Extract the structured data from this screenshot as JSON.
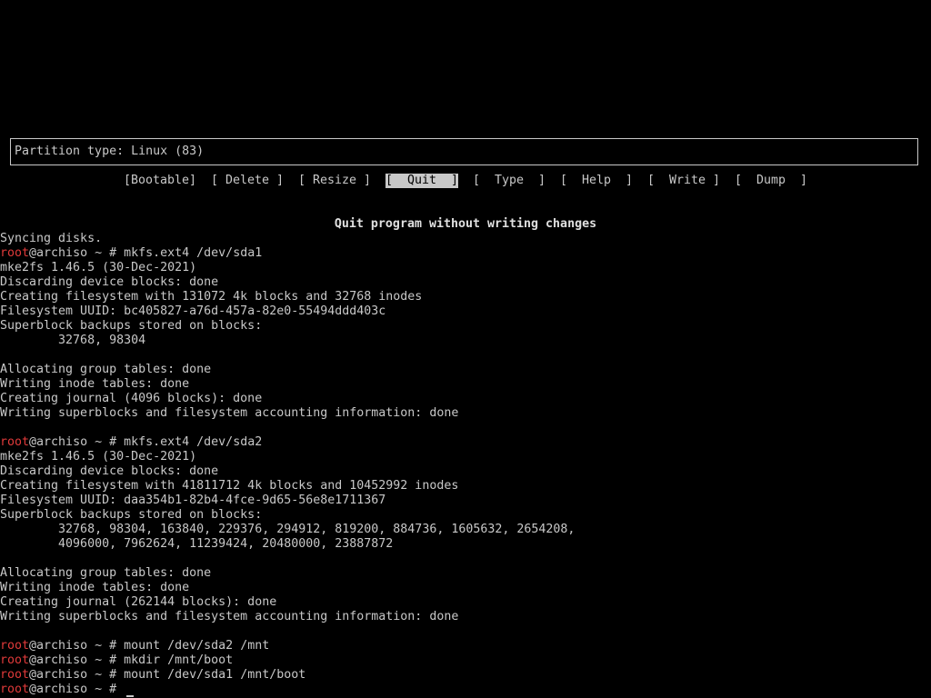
{
  "header": {
    "partition_type": "Partition type: Linux (83)"
  },
  "menu": {
    "items": [
      {
        "label": "[Bootable]"
      },
      {
        "label": "[ Delete ]"
      },
      {
        "label": "[ Resize ]"
      },
      {
        "label": "[  Quit  ]"
      },
      {
        "label": "[  Type  ]"
      },
      {
        "label": "[  Help  ]"
      },
      {
        "label": "[  Write ]"
      },
      {
        "label": "[  Dump  ]"
      }
    ],
    "selected": "Quit"
  },
  "hint": "Quit program without writing changes",
  "console": {
    "root_user": "root",
    "prompt_rest": "@archiso ~ # ",
    "lines": [
      "Syncing disks.",
      "mkfs.ext4 /dev/sda1",
      "mke2fs 1.46.5 (30-Dec-2021)",
      "Discarding device blocks: done",
      "Creating filesystem with 131072 4k blocks and 32768 inodes",
      "Filesystem UUID: bc405827-a76d-457a-82e0-55494ddd403c",
      "Superblock backups stored on blocks:",
      "        32768, 98304",
      "",
      "Allocating group tables: done",
      "Writing inode tables: done",
      "Creating journal (4096 blocks): done",
      "Writing superblocks and filesystem accounting information: done",
      "",
      "mkfs.ext4 /dev/sda2",
      "mke2fs 1.46.5 (30-Dec-2021)",
      "Discarding device blocks: done",
      "Creating filesystem with 41811712 4k blocks and 10452992 inodes",
      "Filesystem UUID: daa354b1-82b4-4fce-9d65-56e8e1711367",
      "Superblock backups stored on blocks:",
      "        32768, 98304, 163840, 229376, 294912, 819200, 884736, 1605632, 2654208,",
      "        4096000, 7962624, 11239424, 20480000, 23887872",
      "",
      "Allocating group tables: done",
      "Writing inode tables: done",
      "Creating journal (262144 blocks): done",
      "Writing superblocks and filesystem accounting information: done",
      "",
      "mount /dev/sda2 /mnt",
      "mkdir /mnt/boot",
      "mount /dev/sda1 /mnt/boot",
      ""
    ]
  },
  "colors": {
    "background": "#000000",
    "foreground": "#c8c8c8",
    "root_user": "#e03a3a"
  }
}
